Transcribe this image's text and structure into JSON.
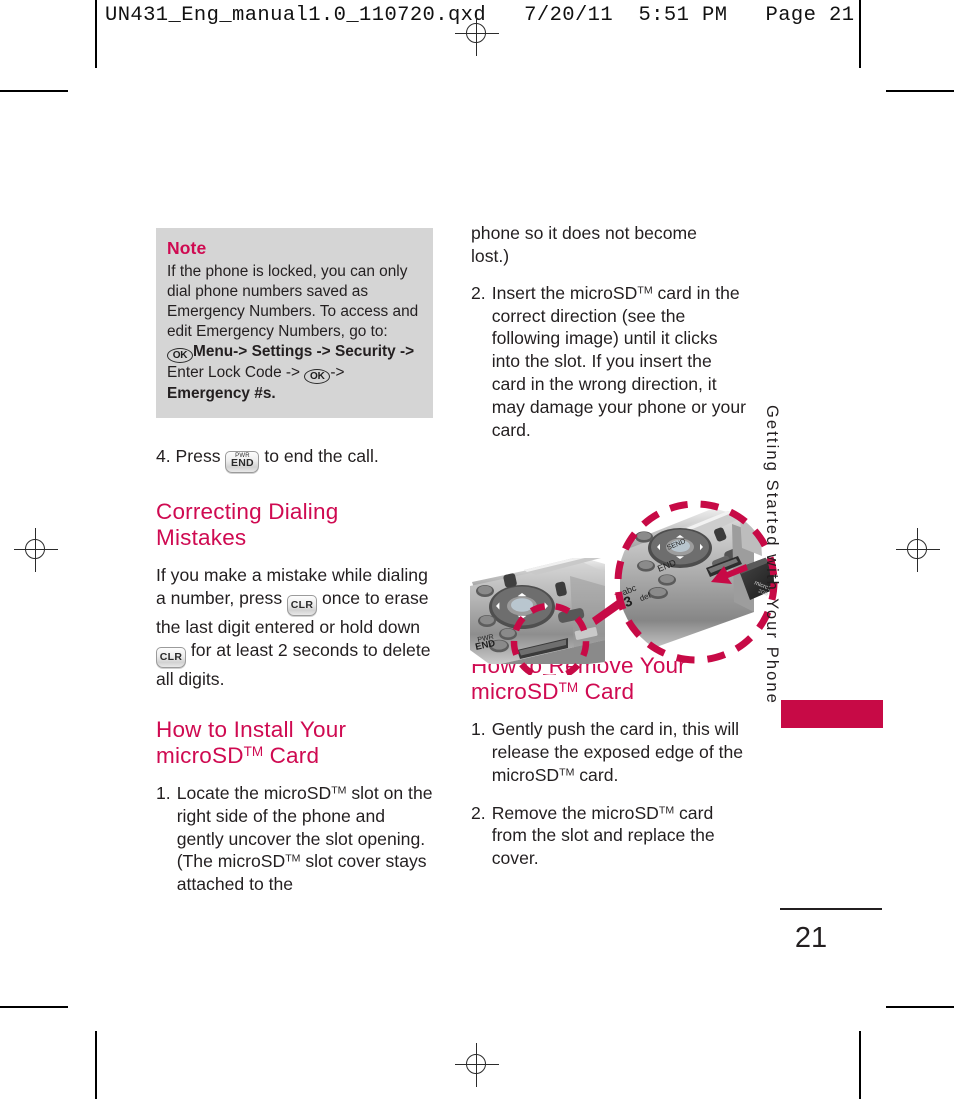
{
  "print_header": "UN431_Eng_manual1.0_110720.qxd   7/20/11  5:51 PM   Page 21",
  "accent_color": "#cf0a51",
  "tab_color": "#c70a46",
  "note_bg_color": "#d5d5d5",
  "note": {
    "title": "Note",
    "line1": "If the phone is locked, you can only",
    "line2": "dial phone numbers saved as",
    "line3": "Emergency Numbers. To access and",
    "line4": "edit Emergency Numbers, go to:",
    "ok_icon_1": "OK",
    "path1": "Menu-> Settings -> Security ->",
    "path2": "Enter Lock Code ->",
    "ok_icon_2": "OK",
    "path3": "->",
    "path4": "Emergency #s."
  },
  "left_column": {
    "step4_num": "4. Press",
    "step4_key_line1": "PWR",
    "step4_key_line2": "END",
    "step4_rest": "to end the call.",
    "heading_correcting": "Correcting Dialing Mistakes",
    "correcting_part1": "If you make a mistake while dialing a number, press",
    "correcting_key1": "CLR",
    "correcting_part2": "once to erase the last digit entered or hold down",
    "correcting_key2": "CLR",
    "correcting_part3": "for at least 2 seconds to delete all digits.",
    "heading_install_line1": "How to Install Your",
    "heading_install_line2a": "microSD",
    "heading_install_tm": "TM",
    "heading_install_line2b": " Card",
    "step1_num": "1.",
    "step1_text_a": "Locate the microSD",
    "step1_tm1": "TM",
    "step1_text_b": " slot on the right side of the phone and gently uncover the slot opening. (The microSD",
    "step1_tm2": "TM",
    "step1_text_c": " slot cover stays attached to the"
  },
  "right_column": {
    "cont_line1": "phone so it does not become",
    "cont_line2": "lost.)",
    "step2_num": "2.",
    "step2_text_a": "Insert the microSD",
    "step2_tm": "TM",
    "step2_text_b": " card in the correct direction (see the following image) until it clicks into the slot. If you insert the card in the wrong direction, it may damage your phone or your card.",
    "heading_remove_line1": "How to Remove Your",
    "heading_remove_line2a": "microSD",
    "heading_remove_tm": "TM",
    "heading_remove_line2b": " Card",
    "r_step1_num": "1.",
    "r_step1_text_a": "Gently push the card in, this will release the exposed edge of the microSD",
    "r_step1_tm": "TM",
    "r_step1_text_b": " card.",
    "r_step2_num": "2.",
    "r_step2_text_a": "Remove the microSD",
    "r_step2_tm": "TM",
    "r_step2_text_b": " card from the slot and replace the cover."
  },
  "side_tab": {
    "label": "Getting Started with Your Phone"
  },
  "folio": {
    "page_number": "21"
  },
  "illustration": {
    "caption": "phone-microsd-slot-diagram",
    "detail_circle_color": "#c70a46",
    "arrow_color": "#c70a46"
  }
}
